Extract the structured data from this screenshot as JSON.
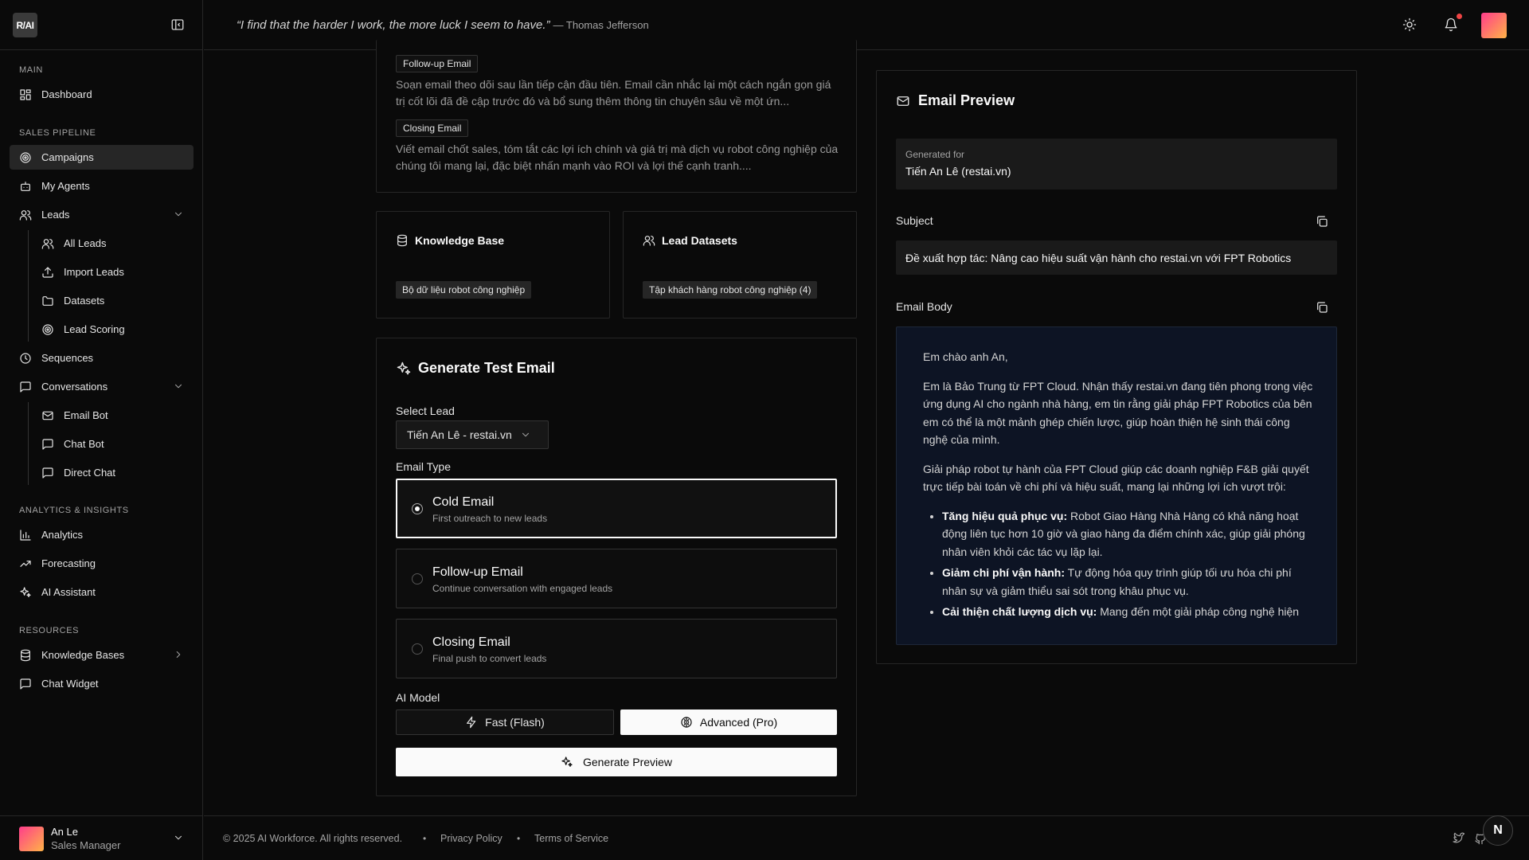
{
  "app": {
    "logo_text": "R/AI"
  },
  "topbar": {
    "quote": "“I find that the harder I work, the more luck I seem to have.”",
    "author": "— Thomas Jefferson"
  },
  "sidebar": {
    "sections": {
      "main": "Main",
      "sales": "Sales Pipeline",
      "analytics": "Analytics & Insights",
      "resources": "Resources"
    },
    "items": {
      "dashboard": "Dashboard",
      "campaigns": "Campaigns",
      "my_agents": "My Agents",
      "leads": "Leads",
      "all_leads": "All Leads",
      "import_leads": "Import Leads",
      "datasets": "Datasets",
      "lead_scoring": "Lead Scoring",
      "sequences": "Sequences",
      "conversations": "Conversations",
      "email_bot": "Email Bot",
      "chat_bot": "Chat Bot",
      "direct_chat": "Direct Chat",
      "analytics": "Analytics",
      "forecasting": "Forecasting",
      "ai_assistant": "AI Assistant",
      "knowledge_bases": "Knowledge Bases",
      "chat_widget": "Chat Widget"
    },
    "active": "campaigns",
    "user": {
      "name": "An Le",
      "role": "Sales Manager"
    }
  },
  "templates": {
    "followup": {
      "tag": "Follow-up Email",
      "desc": "Soạn email theo dõi sau lần tiếp cận đầu tiên. Email cần nhắc lại một cách ngắn gọn giá trị cốt lõi đã đề cập trước đó và bổ sung thêm thông tin chuyên sâu về một ứn..."
    },
    "closing": {
      "tag": "Closing Email",
      "desc": "Viết email chốt sales, tóm tắt các lợi ích chính và giá trị mà dịch vụ robot công nghiệp của chúng tôi mang lại, đặc biệt nhấn mạnh vào ROI và lợi thế cạnh tranh...."
    }
  },
  "knowledge_base": {
    "title": "Knowledge Base",
    "chip": "Bộ dữ liệu robot công nghiệp"
  },
  "lead_datasets": {
    "title": "Lead Datasets",
    "chip": "Tập khách hàng robot công nghiệp (4)"
  },
  "generate": {
    "title": "Generate Test Email",
    "select_lead_label": "Select Lead",
    "selected_lead": "Tiến An Lê - restai.vn",
    "email_type_label": "Email Type",
    "types": [
      {
        "title": "Cold Email",
        "sub": "First outreach to new leads"
      },
      {
        "title": "Follow-up Email",
        "sub": "Continue conversation with engaged leads"
      },
      {
        "title": "Closing Email",
        "sub": "Final push to convert leads"
      }
    ],
    "selected_type": 0,
    "ai_model_label": "AI Model",
    "model_fast": "Fast (Flash)",
    "model_advanced": "Advanced (Pro)",
    "selected_model": "advanced",
    "button": "Generate Preview"
  },
  "preview": {
    "title": "Email Preview",
    "generated_for_label": "Generated for",
    "generated_for": "Tiến An Lê (restai.vn)",
    "subject_label": "Subject",
    "subject": "Đề xuất hợp tác: Nâng cao hiệu suất vận hành cho restai.vn với FPT Robotics",
    "body_label": "Email Body",
    "greeting": "Em chào anh An,",
    "para1": "Em là Bảo Trung từ FPT Cloud. Nhận thấy restai.vn đang tiên phong trong việc ứng dụng AI cho ngành nhà hàng, em tin rằng giải pháp FPT Robotics của bên em có thể là một mảnh ghép chiến lược, giúp hoàn thiện hệ sinh thái công nghệ của mình.",
    "para2": "Giải pháp robot tự hành của FPT Cloud giúp các doanh nghiệp F&B giải quyết trực tiếp bài toán về chi phí và hiệu suất, mang lại những lợi ích vượt trội:",
    "bullets": [
      {
        "bold": "Tăng hiệu quả phục vụ:",
        "text": " Robot Giao Hàng Nhà Hàng có khả năng hoạt động liên tục hơn 10 giờ và giao hàng đa điểm chính xác, giúp giải phóng nhân viên khỏi các tác vụ lặp lại."
      },
      {
        "bold": "Giảm chi phí vận hành:",
        "text": " Tự động hóa quy trình giúp tối ưu hóa chi phí nhân sự và giảm thiểu sai sót trong khâu phục vụ."
      },
      {
        "bold": "Cải thiện chất lượng dịch vụ:",
        "text": " Mang đến một giải pháp công nghệ hiện"
      }
    ]
  },
  "footer": {
    "copyright": "© 2025 AI Workforce. All rights reserved.",
    "privacy": "Privacy Policy",
    "terms": "Terms of Service",
    "badge": "N"
  }
}
